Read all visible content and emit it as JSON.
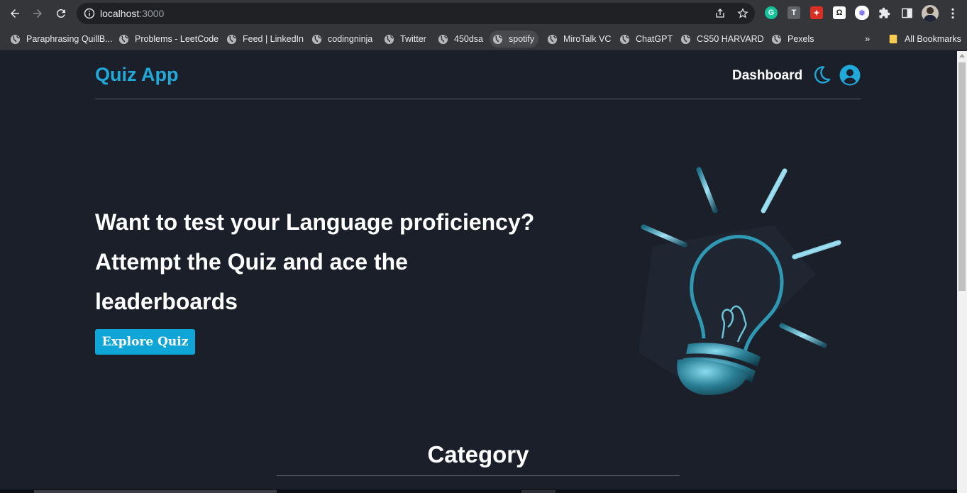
{
  "browser": {
    "url_host": "localhost",
    "url_port": ":3000",
    "bookmarks": [
      {
        "label": "Paraphrasing QuillB..."
      },
      {
        "label": "Problems - LeetCode"
      },
      {
        "label": "Feed | LinkedIn"
      },
      {
        "label": "codingninja"
      },
      {
        "label": "Twitter"
      },
      {
        "label": "450dsa"
      },
      {
        "label": "spotify"
      },
      {
        "label": "MiroTalk VC"
      },
      {
        "label": "ChatGPT"
      },
      {
        "label": "CS50 HARVARD"
      },
      {
        "label": "Pexels"
      }
    ],
    "overflow_label": "»",
    "all_bookmarks_label": "All Bookmarks",
    "extensions": [
      {
        "icon": "grammarly-icon",
        "letter": "G",
        "color": "#15c39a"
      },
      {
        "icon": "t-extension-icon",
        "letter": "T",
        "color": "#5f6368"
      },
      {
        "icon": "red-extension-icon",
        "letter": "✦",
        "color": "#d93025"
      },
      {
        "icon": "omega-extension-icon",
        "letter": "Ω",
        "color": "#ffffff"
      },
      {
        "icon": "snowflake-extension-icon",
        "letter": "❄",
        "color": "#6c63ff"
      }
    ]
  },
  "app": {
    "brand": "Quiz App",
    "nav_dashboard": "Dashboard",
    "accent": "#21a9d9",
    "hero": {
      "line1": "Want to test your Language proficiency?",
      "line2": "Attempt the Quiz and ace the",
      "line3": "leaderboards"
    },
    "explore_button": "Explore Quiz",
    "category_title": "Category"
  }
}
